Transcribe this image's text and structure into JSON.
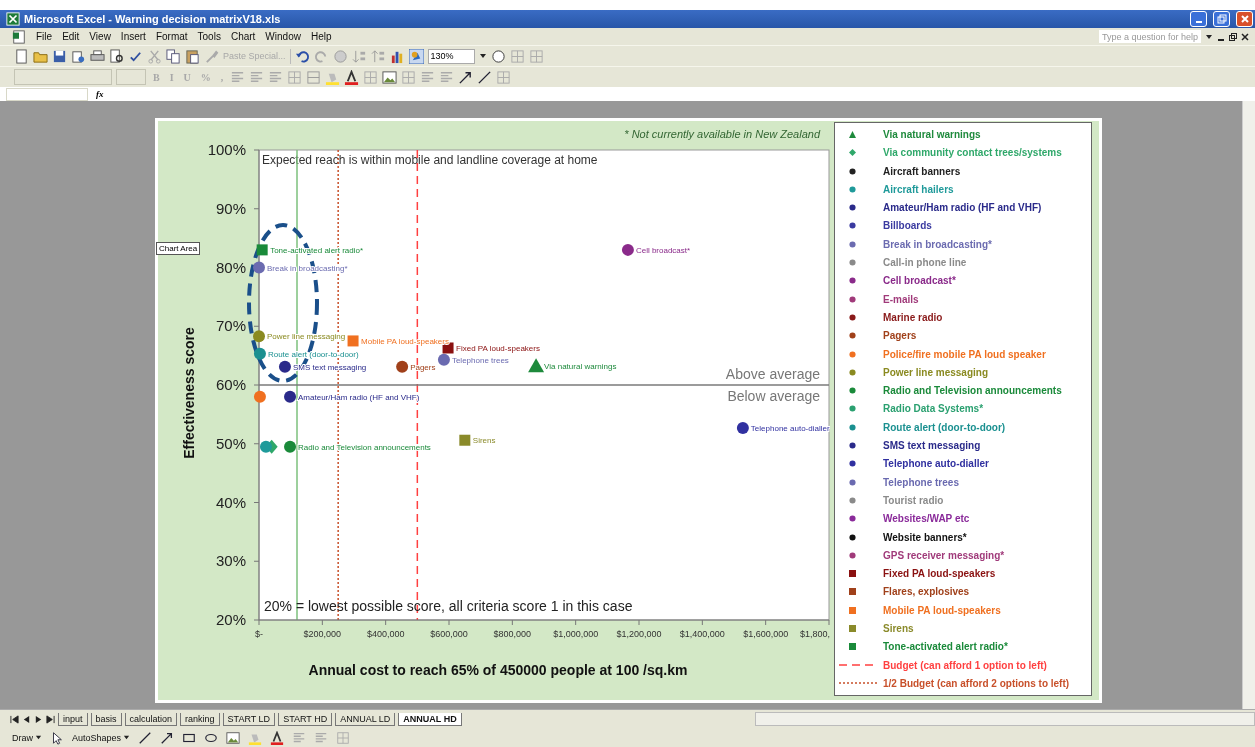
{
  "window": {
    "title": "Microsoft Excel - Warning decision matrixV18.xls"
  },
  "menu": [
    {
      "label": "File"
    },
    {
      "label": "Edit"
    },
    {
      "label": "View"
    },
    {
      "label": "Insert"
    },
    {
      "label": "Format"
    },
    {
      "label": "Tools"
    },
    {
      "label": "Chart"
    },
    {
      "label": "Window"
    },
    {
      "label": "Help"
    }
  ],
  "help_field": {
    "placeholder": "Type a question for help"
  },
  "standard_toolbar": {
    "paste_special": {
      "label": "Paste Special...",
      "disabled": true
    },
    "zoom": "130%"
  },
  "format_toolbar": {
    "buttons": [
      {
        "label": "B",
        "disabled": true
      },
      {
        "label": "I",
        "disabled": true
      },
      {
        "label": "U",
        "disabled": true
      },
      {
        "label": "%",
        "disabled": true
      },
      {
        "label": ",",
        "disabled": true
      }
    ]
  },
  "formula_bar": {
    "fx_label": "fx"
  },
  "chart": {
    "tooltip": "Chart Area",
    "note": "* Not currently available in New Zealand",
    "plot_caption": "Expected reach is within mobile and landline coverage at home",
    "above_label": "Above average",
    "below_label": "Below average",
    "floor_note": "20% = lowest possible score, all criteria score 1 in this case",
    "edge_tick_label": "$1,800,",
    "chart_data": {
      "type": "scatter",
      "xlabel": "Annual cost to reach 65% of 450000 people at 100 /sq.km",
      "ylabel": "Effectiveness score",
      "xlim": [
        0,
        1800000
      ],
      "ylim": [
        20,
        100
      ],
      "xticks": [
        {
          "value": 0,
          "label": "$-"
        },
        {
          "value": 200000,
          "label": "$200,000"
        },
        {
          "value": 400000,
          "label": "$400,000"
        },
        {
          "value": 600000,
          "label": "$600,000"
        },
        {
          "value": 800000,
          "label": "$800,000"
        },
        {
          "value": 1000000,
          "label": "$1,000,000"
        },
        {
          "value": 1200000,
          "label": "$1,200,000"
        },
        {
          "value": 1400000,
          "label": "$1,400,000"
        },
        {
          "value": 1600000,
          "label": "$1,600,000"
        }
      ],
      "yticks": [
        {
          "value": 20,
          "label": "20%"
        },
        {
          "value": 30,
          "label": "30%"
        },
        {
          "value": 40,
          "label": "40%"
        },
        {
          "value": 50,
          "label": "50%"
        },
        {
          "value": 60,
          "label": "60%"
        },
        {
          "value": 70,
          "label": "70%"
        },
        {
          "value": 80,
          "label": "80%"
        },
        {
          "value": 90,
          "label": "90%"
        },
        {
          "value": 100,
          "label": "100%"
        }
      ],
      "series": [
        {
          "name": "Via natural warnings",
          "color": "#1e8a3c",
          "marker": "triangle",
          "x": [
            875000
          ],
          "values": [
            63.2
          ],
          "value_labels": [
            "Via natural warnings"
          ]
        },
        {
          "name": "Via community contact trees/systems",
          "color": "#2fa86a",
          "marker": "diamond",
          "x": [
            40000
          ],
          "values": [
            49.5
          ],
          "value_labels": [
            null
          ]
        },
        {
          "name": "Aircraft banners",
          "color": "#222222",
          "marker": "circle",
          "x": [
            null
          ],
          "values": [
            null
          ]
        },
        {
          "name": "Aircraft hailers",
          "color": "#1f9a9a",
          "marker": "circle",
          "x": [
            22000
          ],
          "values": [
            49.5
          ],
          "value_labels": [
            null
          ]
        },
        {
          "name": "Amateur/Ham radio (HF and VHF)",
          "color": "#2a2a8a",
          "marker": "circle",
          "x": [
            98000
          ],
          "values": [
            58
          ],
          "value_labels": [
            "Amateur/Ham radio (HF and VHF)"
          ]
        },
        {
          "name": "Billboards",
          "color": "#3a3aa0",
          "marker": "circle",
          "x": [
            null
          ],
          "values": [
            null
          ]
        },
        {
          "name": "Break in broadcasting*",
          "color": "#6b6bb0",
          "marker": "circle",
          "x": [
            0
          ],
          "values": [
            80
          ],
          "value_labels": [
            "Break in broadcasting*"
          ]
        },
        {
          "name": "Call-in phone line",
          "color": "#8a8a8a",
          "marker": "circle",
          "x": [
            null
          ],
          "values": [
            null
          ]
        },
        {
          "name": "Cell broadcast*",
          "color": "#8a2a8a",
          "marker": "circle",
          "x": [
            1165000
          ],
          "values": [
            83
          ],
          "value_labels": [
            "Cell broadcast*"
          ]
        },
        {
          "name": "E-mails",
          "color": "#a03a7a",
          "marker": "circle",
          "x": [
            null
          ],
          "values": [
            null
          ]
        },
        {
          "name": "Marine radio",
          "color": "#8a1a1a",
          "marker": "circle",
          "x": [
            null
          ],
          "values": [
            null
          ]
        },
        {
          "name": "Pagers",
          "color": "#a0401a",
          "marker": "circle",
          "x": [
            452000
          ],
          "values": [
            63.1
          ],
          "value_labels": [
            "Pagers"
          ]
        },
        {
          "name": "Police/fire mobile PA loud speaker",
          "color": "#f07020",
          "marker": "circle",
          "x": [
            3000
          ],
          "values": [
            58
          ],
          "value_labels": [
            null
          ]
        },
        {
          "name": "Power line messaging",
          "color": "#8a8a20",
          "marker": "circle",
          "x": [
            0
          ],
          "values": [
            68.3
          ],
          "value_labels": [
            "Power line messaging"
          ]
        },
        {
          "name": "Radio and Television announcements",
          "color": "#1a8a3a",
          "marker": "circle",
          "x": [
            98000
          ],
          "values": [
            49.5
          ],
          "value_labels": [
            "Radio and Television announcements"
          ]
        },
        {
          "name": "Radio Data Systems*",
          "color": "#2aa070",
          "marker": "circle",
          "x": [
            null
          ],
          "values": [
            null
          ]
        },
        {
          "name": "Route alert (door-to-door)",
          "color": "#1a9090",
          "marker": "circle",
          "x": [
            3000
          ],
          "values": [
            65.3
          ],
          "value_labels": [
            "Route alert (door-to-door)"
          ]
        },
        {
          "name": "SMS text messaging",
          "color": "#2a2a8a",
          "marker": "circle",
          "x": [
            82000
          ],
          "values": [
            63.1
          ],
          "value_labels": [
            "SMS text messaging"
          ]
        },
        {
          "name": "Telephone auto-dialler",
          "color": "#3030a0",
          "marker": "circle",
          "x": [
            1528000
          ],
          "values": [
            52.7
          ],
          "value_labels": [
            "Telephone auto-dialler"
          ]
        },
        {
          "name": "Telephone trees",
          "color": "#6a6ab0",
          "marker": "circle",
          "x": [
            584000
          ],
          "values": [
            64.3
          ],
          "value_labels": [
            "Telephone trees"
          ]
        },
        {
          "name": "Tourist radio",
          "color": "#8a8a8a",
          "marker": "circle",
          "x": [
            null
          ],
          "values": [
            null
          ]
        },
        {
          "name": "Websites/WAP etc",
          "color": "#8a2a9a",
          "marker": "circle",
          "x": [
            null
          ],
          "values": [
            null
          ]
        },
        {
          "name": "Website banners*",
          "color": "#111111",
          "marker": "circle",
          "x": [
            null
          ],
          "values": [
            null
          ]
        },
        {
          "name": "GPS receiver messaging*",
          "color": "#a03a7a",
          "marker": "circle",
          "x": [
            null
          ],
          "values": [
            null
          ]
        },
        {
          "name": "Fixed PA loud-speakers",
          "color": "#8a1010",
          "marker": "square",
          "x": [
            597000
          ],
          "values": [
            66.3
          ],
          "value_labels": [
            "Fixed PA loud-speakers"
          ]
        },
        {
          "name": "Flares, explosives",
          "color": "#a0401a",
          "marker": "square",
          "x": [
            null
          ],
          "values": [
            null
          ]
        },
        {
          "name": "Mobile PA loud-speakers",
          "color": "#f07020",
          "marker": "square",
          "x": [
            297000
          ],
          "values": [
            67.5
          ],
          "value_labels": [
            "Mobile PA loud-speakers"
          ]
        },
        {
          "name": "Sirens",
          "color": "#8a8a2a",
          "marker": "square",
          "x": [
            650000
          ],
          "values": [
            50.6
          ],
          "value_labels": [
            "Sirens"
          ]
        },
        {
          "name": "Tone-activated alert radio*",
          "color": "#1a8a3a",
          "marker": "square",
          "x": [
            10000
          ],
          "values": [
            83
          ],
          "value_labels": [
            "Tone-activated alert radio*"
          ]
        }
      ],
      "ref_lines": [
        {
          "axis": "x",
          "value": 500000,
          "label": "Budget (can afford 1 option to left)",
          "color": "#ff4040"
        },
        {
          "axis": "x",
          "value": 250000,
          "label": "1/2 Budget (can afford 2 options to left)",
          "color": "#c8502a"
        },
        {
          "axis": "x",
          "value": 120000,
          "color": "#7cc07c"
        },
        {
          "axis": "y",
          "value": 60,
          "color": "#7a7a7a"
        }
      ]
    }
  },
  "sheet_tabs": [
    {
      "label": "input",
      "selected": false
    },
    {
      "label": "basis",
      "selected": false
    },
    {
      "label": "calculation",
      "selected": false
    },
    {
      "label": "ranking",
      "selected": false
    },
    {
      "label": "START LD",
      "selected": false
    },
    {
      "label": "START HD",
      "selected": false
    },
    {
      "label": "ANNUAL LD",
      "selected": false
    },
    {
      "label": "ANNUAL HD",
      "selected": true
    }
  ],
  "drawing_toolbar": {
    "buttons": [
      {
        "label": "Draw"
      },
      {
        "label": "AutoShapes"
      }
    ]
  }
}
